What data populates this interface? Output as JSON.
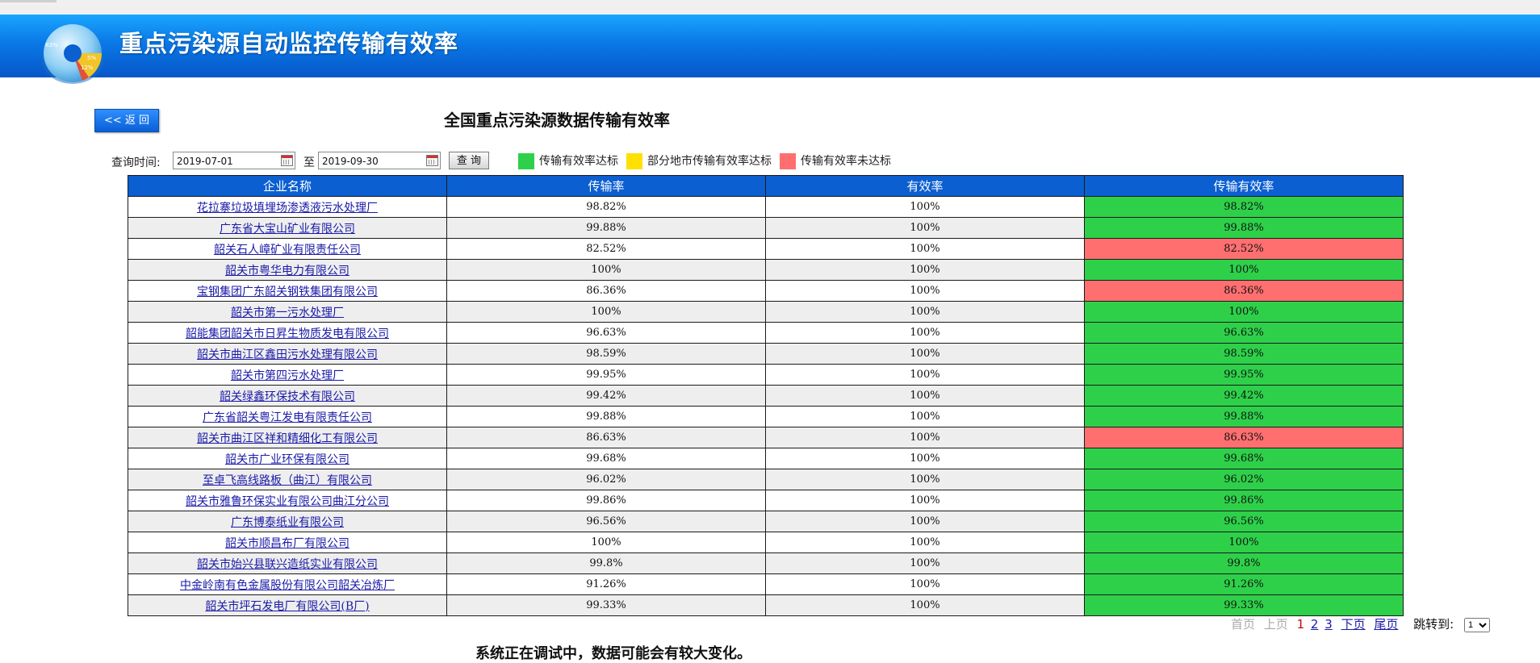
{
  "header": {
    "title": "重点污染源自动监控传输有效率",
    "logo_labels": [
      "83%",
      "5%",
      "12%"
    ]
  },
  "toolbar": {
    "back_label": "<< 返 回"
  },
  "page": {
    "title": "全国重点污染源数据传输有效率"
  },
  "query": {
    "label": "查询时间:",
    "start_date": "2019-07-01",
    "to_label": "至",
    "end_date": "2019-09-30",
    "button_label": "查 询"
  },
  "legend": [
    {
      "label": "传输有效率达标",
      "color": "#2ed04a"
    },
    {
      "label": "部分地市传输有效率达标",
      "color": "#ffe000"
    },
    {
      "label": "传输有效率未达标",
      "color": "#ff6f70"
    }
  ],
  "table": {
    "headers": [
      "企业名称",
      "传输率",
      "有效率",
      "传输有效率"
    ],
    "rows": [
      {
        "name": "花拉寨垃圾填埋场渗透液污水处理厂",
        "transfer": "98.82%",
        "valid": "100%",
        "eff": "98.82%",
        "status": "green"
      },
      {
        "name": "广东省大宝山矿业有限公司",
        "transfer": "99.88%",
        "valid": "100%",
        "eff": "99.88%",
        "status": "green"
      },
      {
        "name": "韶关石人嶂矿业有限责任公司",
        "transfer": "82.52%",
        "valid": "100%",
        "eff": "82.52%",
        "status": "red"
      },
      {
        "name": "韶关市粤华电力有限公司",
        "transfer": "100%",
        "valid": "100%",
        "eff": "100%",
        "status": "green"
      },
      {
        "name": "宝钢集团广东韶关钢铁集团有限公司",
        "transfer": "86.36%",
        "valid": "100%",
        "eff": "86.36%",
        "status": "red"
      },
      {
        "name": "韶关市第一污水处理厂",
        "transfer": "100%",
        "valid": "100%",
        "eff": "100%",
        "status": "green"
      },
      {
        "name": "韶能集团韶关市日昇生物质发电有限公司",
        "transfer": "96.63%",
        "valid": "100%",
        "eff": "96.63%",
        "status": "green"
      },
      {
        "name": "韶关市曲江区鑫田污水处理有限公司",
        "transfer": "98.59%",
        "valid": "100%",
        "eff": "98.59%",
        "status": "green"
      },
      {
        "name": "韶关市第四污水处理厂",
        "transfer": "99.95%",
        "valid": "100%",
        "eff": "99.95%",
        "status": "green"
      },
      {
        "name": "韶关绿鑫环保技术有限公司",
        "transfer": "99.42%",
        "valid": "100%",
        "eff": "99.42%",
        "status": "green"
      },
      {
        "name": "广东省韶关粤江发电有限责任公司",
        "transfer": "99.88%",
        "valid": "100%",
        "eff": "99.88%",
        "status": "green"
      },
      {
        "name": "韶关市曲江区祥和精细化工有限公司",
        "transfer": "86.63%",
        "valid": "100%",
        "eff": "86.63%",
        "status": "red"
      },
      {
        "name": "韶关市广业环保有限公司",
        "transfer": "99.68%",
        "valid": "100%",
        "eff": "99.68%",
        "status": "green"
      },
      {
        "name": "至卓飞高线路板（曲江）有限公司",
        "transfer": "96.02%",
        "valid": "100%",
        "eff": "96.02%",
        "status": "green"
      },
      {
        "name": "韶关市雅鲁环保实业有限公司曲江分公司",
        "transfer": "99.86%",
        "valid": "100%",
        "eff": "99.86%",
        "status": "green"
      },
      {
        "name": "广东博泰纸业有限公司",
        "transfer": "96.56%",
        "valid": "100%",
        "eff": "96.56%",
        "status": "green"
      },
      {
        "name": "韶关市顺昌布厂有限公司",
        "transfer": "100%",
        "valid": "100%",
        "eff": "100%",
        "status": "green"
      },
      {
        "name": "韶关市始兴县联兴造纸实业有限公司",
        "transfer": "99.8%",
        "valid": "100%",
        "eff": "99.8%",
        "status": "green"
      },
      {
        "name": "中金岭南有色金属股份有限公司韶关冶炼厂",
        "transfer": "91.26%",
        "valid": "100%",
        "eff": "91.26%",
        "status": "green"
      },
      {
        "name": "韶关市坪石发电厂有限公司(B厂)",
        "transfer": "99.33%",
        "valid": "100%",
        "eff": "99.33%",
        "status": "green"
      }
    ]
  },
  "pager": {
    "first": "首页",
    "prev": "上页",
    "pages": [
      "1",
      "2",
      "3"
    ],
    "current": "1",
    "next": "下页",
    "last": "尾页",
    "jump_label": "跳转到:",
    "jump_value": "1"
  },
  "footer": {
    "note": "系统正在调试中，数据可能会有较大变化。"
  }
}
